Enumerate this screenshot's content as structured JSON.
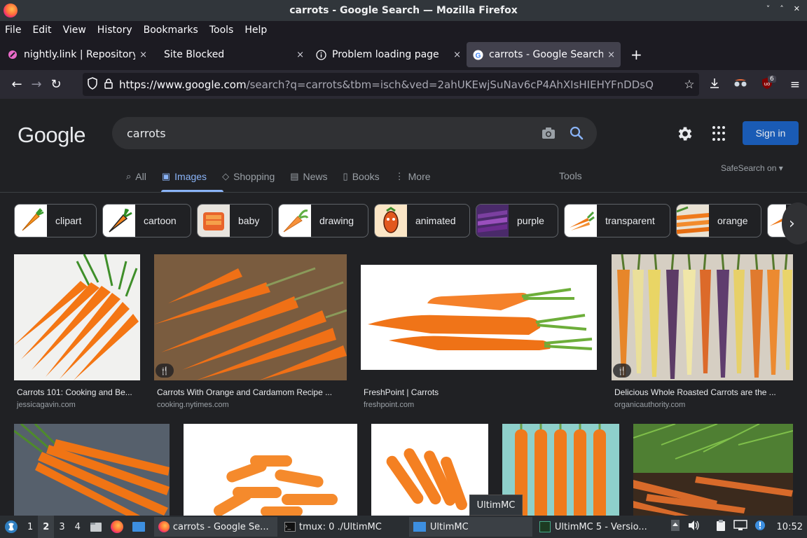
{
  "window": {
    "title": "carrots - Google Search — Mozilla Firefox",
    "controls": [
      "˅",
      "˄",
      "✕"
    ]
  },
  "menu": [
    "File",
    "Edit",
    "View",
    "History",
    "Bookmarks",
    "Tools",
    "Help"
  ],
  "tabs": [
    {
      "label": "nightly.link | Repository",
      "close": "×"
    },
    {
      "label": "Site Blocked",
      "close": "×"
    },
    {
      "label": "Problem loading page",
      "close": "×"
    },
    {
      "label": "carrots - Google Search",
      "close": "×"
    }
  ],
  "newtab": "+",
  "nav": {
    "url_host": "https://www.google.com",
    "url_rest": "/search?q=carrots&tbm=isch&ved=2ahUKEwjSuNav6cP4AhXIsHIEHYFnDDsQ",
    "extension_badge": "6"
  },
  "google": {
    "logo": "Google",
    "query": "carrots",
    "signin": "Sign in",
    "tabs": [
      {
        "icon": "⌕",
        "label": "All"
      },
      {
        "icon": "▣",
        "label": "Images"
      },
      {
        "icon": "◇",
        "label": "Shopping"
      },
      {
        "icon": "▤",
        "label": "News"
      },
      {
        "icon": "▯",
        "label": "Books"
      },
      {
        "icon": "⋮",
        "label": "More"
      }
    ],
    "tools": "Tools",
    "safesearch": "SafeSearch on ▾",
    "chips": [
      "clipart",
      "cartoon",
      "baby",
      "drawing",
      "animated",
      "purple",
      "transparent",
      "orange"
    ],
    "results_row1": [
      {
        "caption": "Carrots 101: Cooking and Be...",
        "source": "jessicagavin.com"
      },
      {
        "caption": "Carrots With Orange and Cardamom Recipe ...",
        "source": "cooking.nytimes.com"
      },
      {
        "caption": "FreshPoint | Carrots",
        "source": "freshpoint.com"
      },
      {
        "caption": "Delicious Whole Roasted Carrots are the ...",
        "source": "organicauthority.com"
      }
    ]
  },
  "tooltip": "UltimMC",
  "taskbar": {
    "workspaces": [
      "1",
      "2",
      "3",
      "4"
    ],
    "tasks": [
      {
        "label": "carrots - Google Se..."
      },
      {
        "label": "tmux: 0 ./UltimMC"
      },
      {
        "label": "UltimMC"
      },
      {
        "label": "UltimMC 5 - Versio..."
      }
    ],
    "clock": "10:52"
  },
  "colors": {
    "accent_blue": "#8ab4f8",
    "signin_bg": "#1a5bb5",
    "page_bg": "#202124",
    "carrot_orange": "#f07a1a"
  }
}
